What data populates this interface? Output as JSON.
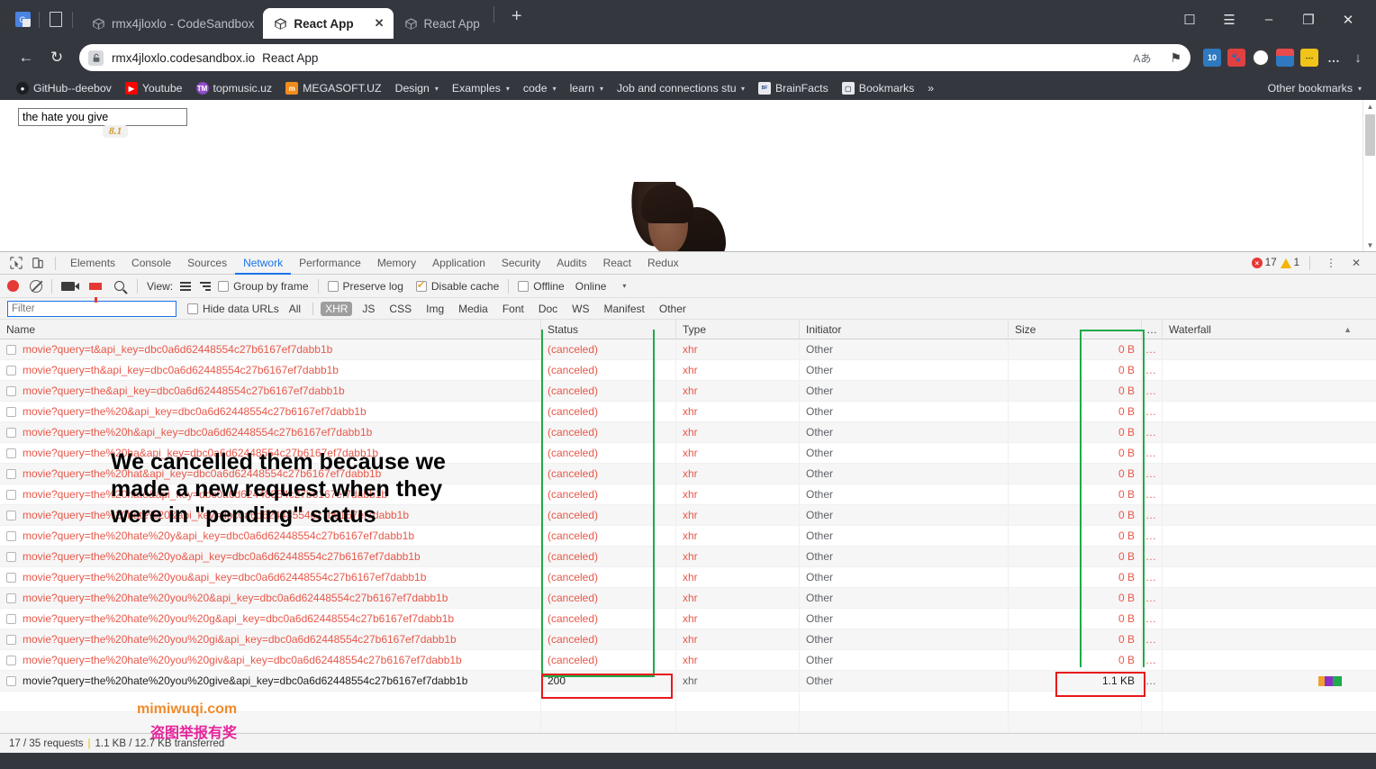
{
  "browser": {
    "tabs": [
      {
        "title": "rmx4jloxlo - CodeSandbox",
        "icon": "codesandbox-icon",
        "active": false,
        "close": ""
      },
      {
        "title": "React App",
        "icon": "react-icon",
        "active": true,
        "close": "✕"
      },
      {
        "title": "React App",
        "icon": "react-icon",
        "active": false,
        "close": ""
      }
    ],
    "new_tab_label": "+",
    "system_icons": [
      "google-translate-icon",
      "page-icon"
    ],
    "window_controls": [
      "collections-icon",
      "menu-icon",
      "minimize-icon",
      "restore-icon",
      "close-icon"
    ],
    "window_control_glyphs": {
      "collections": "☐",
      "menu": "☰",
      "minimize": "–",
      "restore": "❐",
      "close": "✕"
    },
    "nav": {
      "back": "←",
      "reload": "↻"
    },
    "omnibox": {
      "host": "rmx4jloxlo.codesandbox.io",
      "page_title": "React App",
      "read_aloud": "Aあ",
      "favorite": "⚑"
    },
    "extensions": [
      "tab-counter-10",
      "red-extension",
      "target-extension",
      "lighthouse-extension",
      "yellow-extension",
      "more-extensions",
      "downloads-icon"
    ],
    "extension_more": "…",
    "bookmarks": [
      {
        "label": "GitHub--deebov",
        "icon": "github-icon",
        "caret": ""
      },
      {
        "label": "Youtube",
        "icon": "youtube-icon",
        "caret": ""
      },
      {
        "label": "topmusic.uz",
        "icon": "topmusic-icon",
        "caret": ""
      },
      {
        "label": "MEGASOFT.UZ",
        "icon": "megasoft-icon",
        "caret": ""
      },
      {
        "label": "Design",
        "icon": "",
        "caret": "▾"
      },
      {
        "label": "Examples",
        "icon": "",
        "caret": "▾"
      },
      {
        "label": "code",
        "icon": "",
        "caret": "▾"
      },
      {
        "label": "learn",
        "icon": "",
        "caret": "▾"
      },
      {
        "label": "Job and connections stu",
        "icon": "",
        "caret": "▾"
      },
      {
        "label": "BrainFacts",
        "icon": "brainfacts-icon",
        "caret": ""
      },
      {
        "label": "Bookmarks",
        "icon": "bookmarks-folder-icon",
        "caret": ""
      }
    ],
    "bookmarks_overflow": "»",
    "other_bookmarks": "Other bookmarks",
    "other_bookmarks_caret": "▾"
  },
  "page": {
    "search_value": "the hate you give",
    "search_placeholder": "",
    "movie_rating": "8.1"
  },
  "devtools": {
    "panel_tabs": [
      {
        "label": "Elements",
        "active": false
      },
      {
        "label": "Console",
        "active": false
      },
      {
        "label": "Sources",
        "active": false
      },
      {
        "label": "Network",
        "active": true
      },
      {
        "label": "Performance",
        "active": false
      },
      {
        "label": "Memory",
        "active": false
      },
      {
        "label": "Application",
        "active": false
      },
      {
        "label": "Security",
        "active": false
      },
      {
        "label": "Audits",
        "active": false
      },
      {
        "label": "React",
        "active": false
      },
      {
        "label": "Redux",
        "active": false
      }
    ],
    "error_count": "17",
    "warning_count": "1",
    "error_glyph": "×",
    "more_glyph": "⋮",
    "close_glyph": "✕",
    "toolbar": {
      "record": "record-button",
      "clear": "clear-button",
      "capture_screenshots": "camera-button",
      "filter": "filter-button",
      "search": "search-button",
      "view_label": "View:",
      "group_by_frame": "Group by frame",
      "group_by_frame_checked": false,
      "preserve_log": "Preserve log",
      "preserve_log_checked": false,
      "disable_cache": "Disable cache",
      "disable_cache_checked": true,
      "offline": "Offline",
      "offline_checked": false,
      "throttling": "Online",
      "throttling_caret": "▾"
    },
    "filterbar": {
      "filter_placeholder": "Filter",
      "filter_value": "",
      "hide_data_urls": "Hide data URLs",
      "hide_data_urls_checked": false,
      "types": [
        {
          "label": "All",
          "selected": false
        },
        {
          "label": "XHR",
          "selected": true
        },
        {
          "label": "JS",
          "selected": false
        },
        {
          "label": "CSS",
          "selected": false
        },
        {
          "label": "Img",
          "selected": false
        },
        {
          "label": "Media",
          "selected": false
        },
        {
          "label": "Font",
          "selected": false
        },
        {
          "label": "Doc",
          "selected": false
        },
        {
          "label": "WS",
          "selected": false
        },
        {
          "label": "Manifest",
          "selected": false
        },
        {
          "label": "Other",
          "selected": false
        }
      ]
    },
    "table": {
      "columns": [
        "Name",
        "Status",
        "Type",
        "Initiator",
        "Size",
        "…",
        "Waterfall"
      ],
      "sort_indicator": "▲",
      "rows": [
        {
          "name": "movie?query=t&api_key=dbc0a6d62448554c27b6167ef7dabb1b",
          "status": "(canceled)",
          "type": "xhr",
          "initiator": "Other",
          "size": "0 B",
          "overflow": "…",
          "waterfall": false
        },
        {
          "name": "movie?query=th&api_key=dbc0a6d62448554c27b6167ef7dabb1b",
          "status": "(canceled)",
          "type": "xhr",
          "initiator": "Other",
          "size": "0 B",
          "overflow": "…",
          "waterfall": false
        },
        {
          "name": "movie?query=the&api_key=dbc0a6d62448554c27b6167ef7dabb1b",
          "status": "(canceled)",
          "type": "xhr",
          "initiator": "Other",
          "size": "0 B",
          "overflow": "…",
          "waterfall": false
        },
        {
          "name": "movie?query=the%20&api_key=dbc0a6d62448554c27b6167ef7dabb1b",
          "status": "(canceled)",
          "type": "xhr",
          "initiator": "Other",
          "size": "0 B",
          "overflow": "…",
          "waterfall": false
        },
        {
          "name": "movie?query=the%20h&api_key=dbc0a6d62448554c27b6167ef7dabb1b",
          "status": "(canceled)",
          "type": "xhr",
          "initiator": "Other",
          "size": "0 B",
          "overflow": "…",
          "waterfall": false
        },
        {
          "name": "movie?query=the%20ha&api_key=dbc0a6d62448554c27b6167ef7dabb1b",
          "status": "(canceled)",
          "type": "xhr",
          "initiator": "Other",
          "size": "0 B",
          "overflow": "…",
          "waterfall": false
        },
        {
          "name": "movie?query=the%20hat&api_key=dbc0a6d62448554c27b6167ef7dabb1b",
          "status": "(canceled)",
          "type": "xhr",
          "initiator": "Other",
          "size": "0 B",
          "overflow": "…",
          "waterfall": false
        },
        {
          "name": "movie?query=the%20hate&api_key=dbc0a6d62448554c27b6167ef7dabb1b",
          "status": "(canceled)",
          "type": "xhr",
          "initiator": "Other",
          "size": "0 B",
          "overflow": "…",
          "waterfall": false
        },
        {
          "name": "movie?query=the%20hate%20&api_key=dbc0a6d62448554c27b6167ef7dabb1b",
          "status": "(canceled)",
          "type": "xhr",
          "initiator": "Other",
          "size": "0 B",
          "overflow": "…",
          "waterfall": false
        },
        {
          "name": "movie?query=the%20hate%20y&api_key=dbc0a6d62448554c27b6167ef7dabb1b",
          "status": "(canceled)",
          "type": "xhr",
          "initiator": "Other",
          "size": "0 B",
          "overflow": "…",
          "waterfall": false
        },
        {
          "name": "movie?query=the%20hate%20yo&api_key=dbc0a6d62448554c27b6167ef7dabb1b",
          "status": "(canceled)",
          "type": "xhr",
          "initiator": "Other",
          "size": "0 B",
          "overflow": "…",
          "waterfall": false
        },
        {
          "name": "movie?query=the%20hate%20you&api_key=dbc0a6d62448554c27b6167ef7dabb1b",
          "status": "(canceled)",
          "type": "xhr",
          "initiator": "Other",
          "size": "0 B",
          "overflow": "…",
          "waterfall": false
        },
        {
          "name": "movie?query=the%20hate%20you%20&api_key=dbc0a6d62448554c27b6167ef7dabb1b",
          "status": "(canceled)",
          "type": "xhr",
          "initiator": "Other",
          "size": "0 B",
          "overflow": "…",
          "waterfall": false
        },
        {
          "name": "movie?query=the%20hate%20you%20g&api_key=dbc0a6d62448554c27b6167ef7dabb1b",
          "status": "(canceled)",
          "type": "xhr",
          "initiator": "Other",
          "size": "0 B",
          "overflow": "…",
          "waterfall": false
        },
        {
          "name": "movie?query=the%20hate%20you%20gi&api_key=dbc0a6d62448554c27b6167ef7dabb1b",
          "status": "(canceled)",
          "type": "xhr",
          "initiator": "Other",
          "size": "0 B",
          "overflow": "…",
          "waterfall": false
        },
        {
          "name": "movie?query=the%20hate%20you%20giv&api_key=dbc0a6d62448554c27b6167ef7dabb1b",
          "status": "(canceled)",
          "type": "xhr",
          "initiator": "Other",
          "size": "0 B",
          "overflow": "…",
          "waterfall": false
        },
        {
          "name": "movie?query=the%20hate%20you%20give&api_key=dbc0a6d62448554c27b6167ef7dabb1b",
          "status": "200",
          "type": "xhr",
          "initiator": "Other",
          "size": "1.1 KB",
          "overflow": "…",
          "waterfall": true
        }
      ]
    },
    "status_bar": {
      "requests": "17 / 35 requests",
      "separator": "|",
      "transferred": "1.1 KB / 12.7 KB transferred"
    }
  },
  "annotations": {
    "note_lines": [
      "We cancelled them because we",
      "made a new request when they",
      "were in \"pending\" status"
    ],
    "colors": {
      "green_box": "#1faa4b",
      "red_box": "#e8191b",
      "note_text": "#000000"
    }
  },
  "watermark": {
    "english": "mimiwuqi.com",
    "chinese": "盗图举报有奖",
    "english_color": "#f18a2a",
    "chinese_color": "#e6249b"
  }
}
